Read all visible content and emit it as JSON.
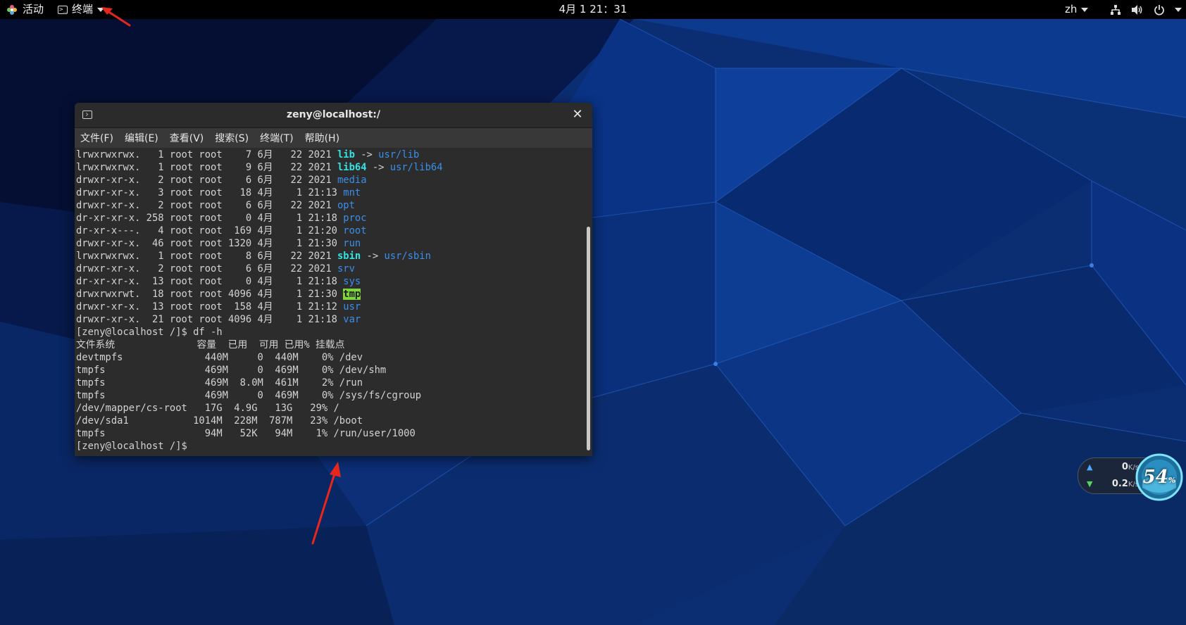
{
  "topbar": {
    "activities": "活动",
    "app_menu": "终端",
    "clock": "4月 1 21：31",
    "lang": "zh"
  },
  "window": {
    "title": "zeny@localhost:/",
    "menus": [
      "文件(F)",
      "编辑(E)",
      "查看(V)",
      "搜索(S)",
      "终端(T)",
      "帮助(H)"
    ]
  },
  "terminal": {
    "ls_rows": [
      {
        "meta": "lrwxrwxrwx.   1 root root    7 6月   22 2021 ",
        "name": "lib",
        "type": "link",
        "target": "usr/lib"
      },
      {
        "meta": "lrwxrwxrwx.   1 root root    9 6月   22 2021 ",
        "name": "lib64",
        "type": "link",
        "target": "usr/lib64"
      },
      {
        "meta": "drwxr-xr-x.   2 root root    6 6月   22 2021 ",
        "name": "media",
        "type": "dir",
        "target": ""
      },
      {
        "meta": "drwxr-xr-x.   3 root root   18 4月    1 21:13 ",
        "name": "mnt",
        "type": "dir",
        "target": ""
      },
      {
        "meta": "drwxr-xr-x.   2 root root    6 6月   22 2021 ",
        "name": "opt",
        "type": "dir",
        "target": ""
      },
      {
        "meta": "dr-xr-xr-x. 258 root root    0 4月    1 21:18 ",
        "name": "proc",
        "type": "dir",
        "target": ""
      },
      {
        "meta": "dr-xr-x---.   4 root root  169 4月    1 21:20 ",
        "name": "root",
        "type": "dir",
        "target": ""
      },
      {
        "meta": "drwxr-xr-x.  46 root root 1320 4月    1 21:30 ",
        "name": "run",
        "type": "dir",
        "target": ""
      },
      {
        "meta": "lrwxrwxrwx.   1 root root    8 6月   22 2021 ",
        "name": "sbin",
        "type": "link",
        "target": "usr/sbin"
      },
      {
        "meta": "drwxr-xr-x.   2 root root    6 6月   22 2021 ",
        "name": "srv",
        "type": "dir",
        "target": ""
      },
      {
        "meta": "dr-xr-xr-x.  13 root root    0 4月    1 21:18 ",
        "name": "sys",
        "type": "dir",
        "target": ""
      },
      {
        "meta": "drwxrwxrwt.  18 root root 4096 4月    1 21:30 ",
        "name": "tmp",
        "type": "tmp",
        "target": ""
      },
      {
        "meta": "drwxr-xr-x.  13 root root  158 4月    1 21:12 ",
        "name": "usr",
        "type": "dir",
        "target": ""
      },
      {
        "meta": "drwxr-xr-x.  21 root root 4096 4月    1 21:18 ",
        "name": "var",
        "type": "dir",
        "target": ""
      }
    ],
    "link_arrow": " -> ",
    "df_command": "[zeny@localhost /]$ df -h",
    "df_header": "文件系统              容量  已用  可用 已用% 挂载点",
    "df_rows": [
      "devtmpfs              440M     0  440M    0% /dev",
      "tmpfs                 469M     0  469M    0% /dev/shm",
      "tmpfs                 469M  8.0M  461M    2% /run",
      "tmpfs                 469M     0  469M    0% /sys/fs/cgroup",
      "/dev/mapper/cs-root   17G  4.9G   13G   29% /",
      "/dev/sda1           1014M  228M  787M   23% /boot",
      "tmpfs                 94M   52K   94M    1% /run/user/1000"
    ],
    "prompt": "[zeny@localhost /]$ "
  },
  "colors": {
    "link": "#34e2e2",
    "dir": "#3b8eea",
    "tmp_bg": "#7fd63c",
    "annotation_arrow": "#e8261c"
  },
  "net_widget": {
    "upload_value": "0",
    "upload_unit": "K/s",
    "download_value": "0.2",
    "download_unit": "K/s",
    "gauge_value": "54",
    "gauge_unit": "%"
  },
  "icons": {
    "activities": "gnome-flower-icon",
    "app_menu": "terminal-icon",
    "tray": [
      "network-icon",
      "volume-icon",
      "power-icon"
    ]
  }
}
